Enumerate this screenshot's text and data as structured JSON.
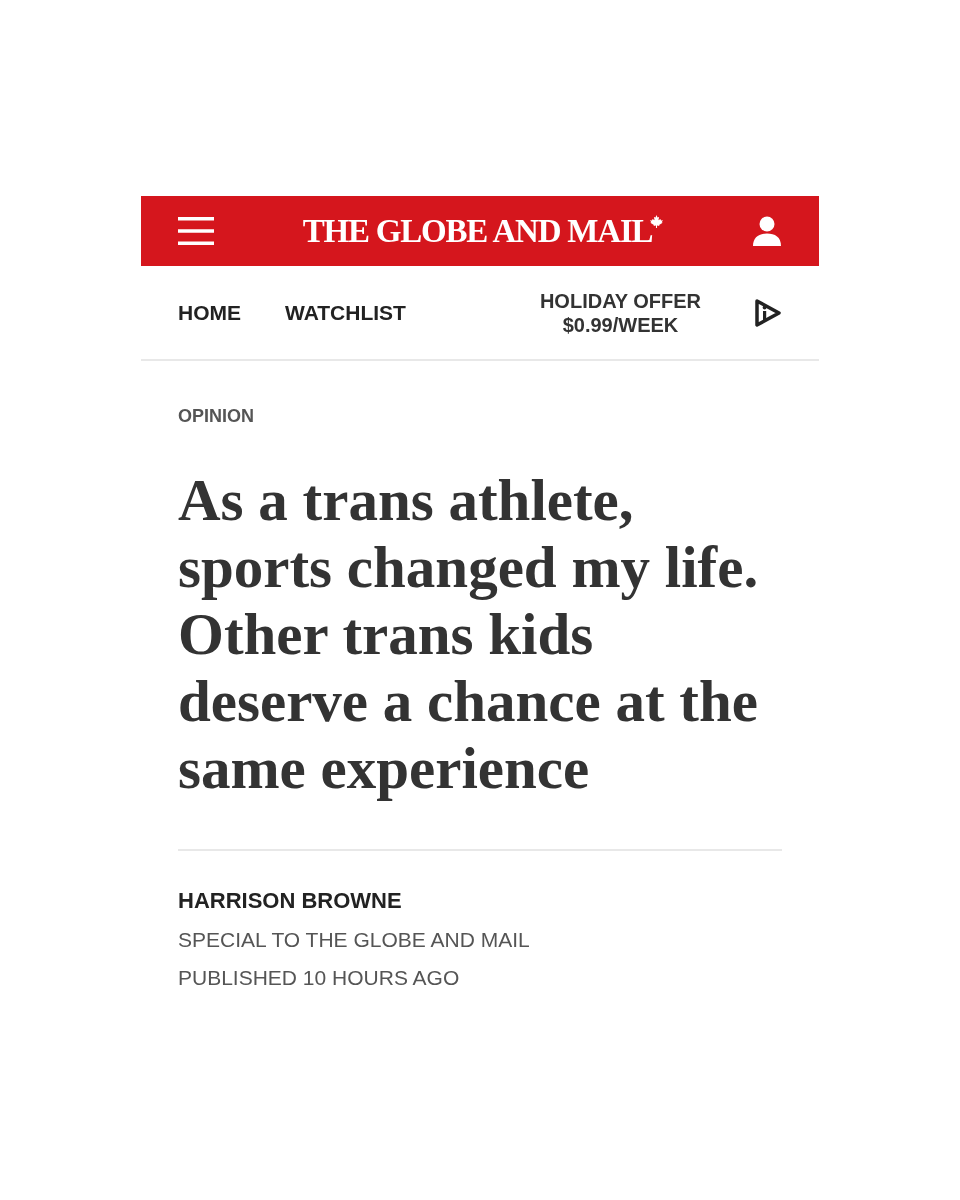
{
  "header": {
    "logo": "THE GLOBE AND MAIL"
  },
  "nav": {
    "links": [
      {
        "label": "HOME"
      },
      {
        "label": "WATCHLIST"
      }
    ],
    "offer": "HOLIDAY OFFER $0.99/WEEK"
  },
  "article": {
    "section": "OPINION",
    "headline_lines": [
      "As a trans athlete,",
      "sports changed my life.",
      "Other trans kids",
      "deserve a chance at the",
      "same experience"
    ],
    "author": "HARRISON BROWNE",
    "affiliation": "SPECIAL TO THE GLOBE AND MAIL",
    "published": "PUBLISHED 10 HOURS AGO"
  }
}
